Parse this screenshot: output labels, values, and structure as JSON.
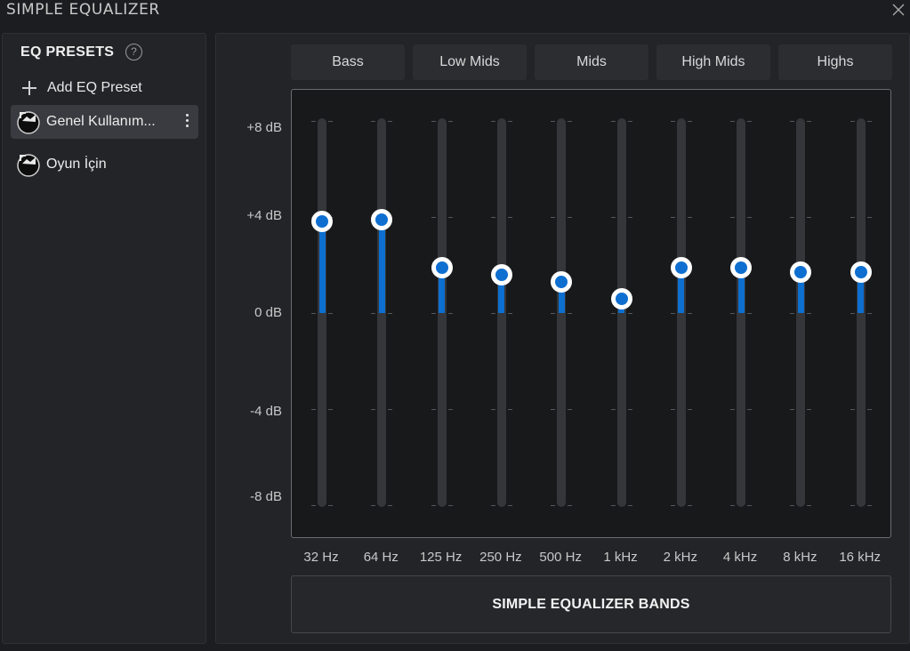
{
  "window": {
    "title": "SIMPLE EQUALIZER"
  },
  "presets": {
    "title": "EQ PRESETS",
    "add_label": "Add EQ Preset",
    "items": [
      {
        "label": "Genel Kullanım...",
        "selected": true
      },
      {
        "label": "Oyun İçin",
        "selected": false
      }
    ]
  },
  "eq": {
    "band_tabs": [
      "Bass",
      "Low Mids",
      "Mids",
      "High Mids",
      "Highs"
    ],
    "db_labels": [
      "+8 dB",
      "+4 dB",
      "0 dB",
      "-4 dB",
      "-8 dB"
    ],
    "sliders": [
      {
        "freq": "32 Hz",
        "gain_db": 3.8
      },
      {
        "freq": "64 Hz",
        "gain_db": 3.9
      },
      {
        "freq": "125 Hz",
        "gain_db": 1.9
      },
      {
        "freq": "250 Hz",
        "gain_db": 1.6
      },
      {
        "freq": "500 Hz",
        "gain_db": 1.3
      },
      {
        "freq": "1 kHz",
        "gain_db": 0.6
      },
      {
        "freq": "2 kHz",
        "gain_db": 1.9
      },
      {
        "freq": "4 kHz",
        "gain_db": 1.9
      },
      {
        "freq": "8 kHz",
        "gain_db": 1.7
      },
      {
        "freq": "16 kHz",
        "gain_db": 1.7
      }
    ],
    "range_db": [
      -12,
      12
    ],
    "bands_button": "SIMPLE EQUALIZER BANDS"
  },
  "colors": {
    "accent": "#0f6fd0",
    "background": "#1c1d20",
    "panel": "#232428"
  }
}
